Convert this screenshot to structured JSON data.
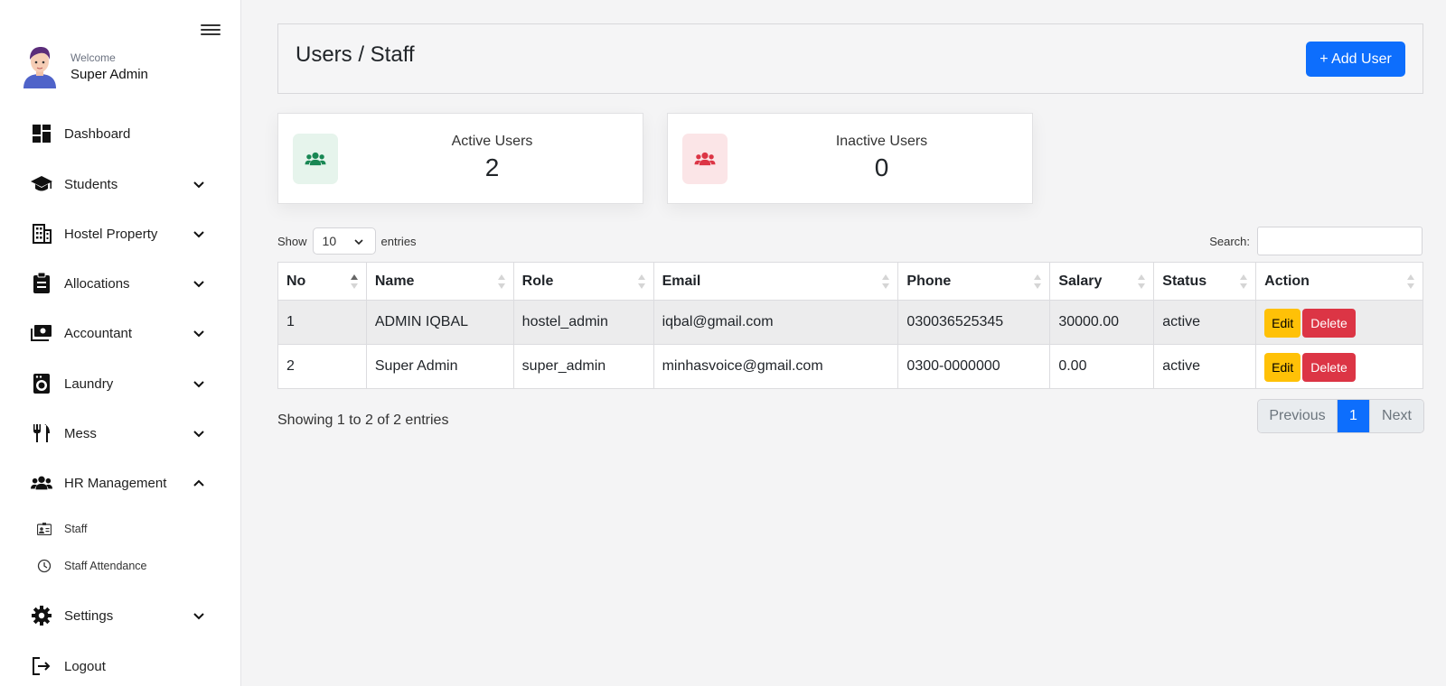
{
  "sidebar": {
    "welcome": "Welcome",
    "user_name": "Super Admin",
    "items": [
      {
        "label": "Dashboard"
      },
      {
        "label": "Students"
      },
      {
        "label": "Hostel Property"
      },
      {
        "label": "Allocations"
      },
      {
        "label": "Accountant"
      },
      {
        "label": "Laundry"
      },
      {
        "label": "Mess"
      },
      {
        "label": "HR Management"
      },
      {
        "label": "Settings"
      },
      {
        "label": "Logout"
      }
    ],
    "sub_items": [
      {
        "label": "Staff"
      },
      {
        "label": "Staff Attendance"
      }
    ]
  },
  "header": {
    "title": "Users / Staff",
    "add_label": "+ Add User"
  },
  "stats": {
    "active": {
      "label": "Active Users",
      "value": "2"
    },
    "inactive": {
      "label": "Inactive Users",
      "value": "0"
    }
  },
  "table_controls": {
    "show": "Show",
    "entries": "entries",
    "page_size": "10",
    "search_label": "Search:",
    "search_value": ""
  },
  "table": {
    "headers": [
      "No",
      "Name",
      "Role",
      "Email",
      "Phone",
      "Salary",
      "Status",
      "Action"
    ],
    "rows": [
      {
        "no": "1",
        "name": "ADMIN IQBAL",
        "role": "hostel_admin",
        "email": "iqbal@gmail.com",
        "phone": "030036525345",
        "salary": "30000.00",
        "status": "active"
      },
      {
        "no": "2",
        "name": "Super Admin",
        "role": "super_admin",
        "email": "minhasvoice@gmail.com",
        "phone": "0300-0000000",
        "salary": "0.00",
        "status": "active"
      }
    ],
    "edit_label": "Edit",
    "delete_label": "Delete"
  },
  "footer": {
    "info": "Showing 1 to 2 of 2 entries",
    "previous": "Previous",
    "page": "1",
    "next": "Next"
  },
  "colors": {
    "primary": "#0d6efd",
    "edit": "#ffc107",
    "delete": "#dc3545",
    "active_icon": "#198754",
    "inactive_icon": "#dc3545"
  }
}
